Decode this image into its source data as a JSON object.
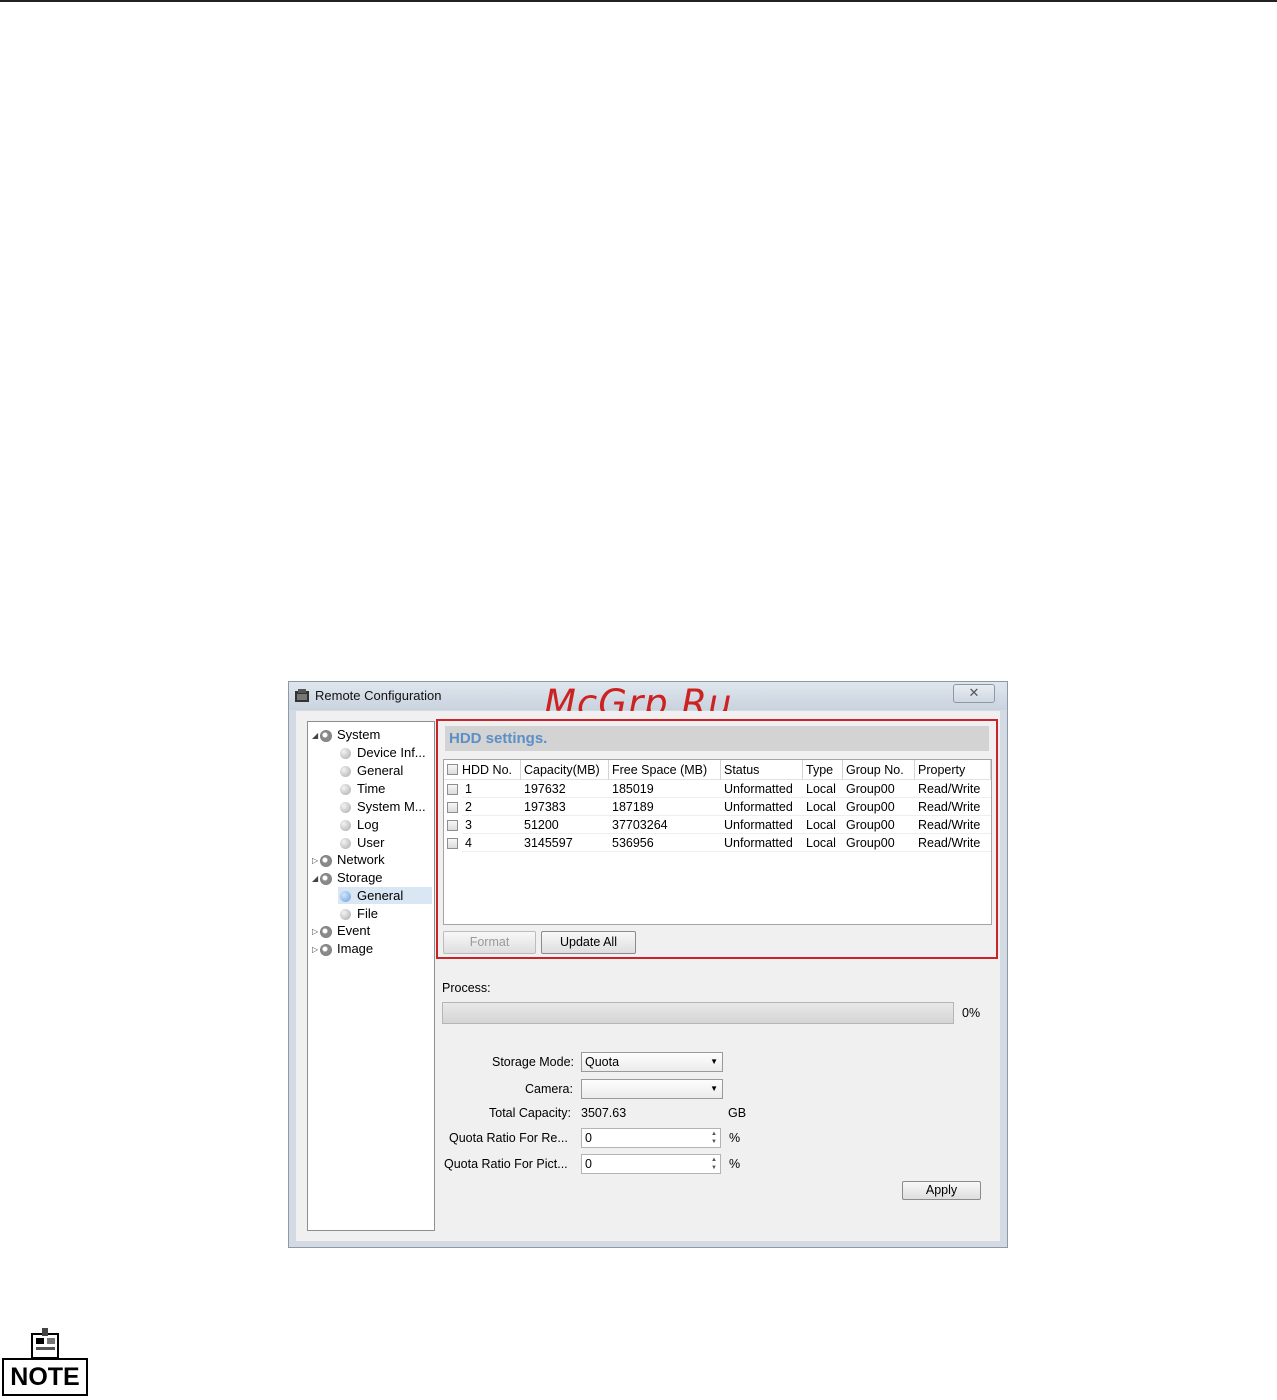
{
  "window": {
    "title": "Remote Configuration",
    "close_glyph": "✕",
    "watermark": "McGrp.Ru"
  },
  "tree": {
    "system": "System",
    "device_info": "Device Inf...",
    "general_sys": "General",
    "time": "Time",
    "system_m": "System M...",
    "log": "Log",
    "user": "User",
    "network": "Network",
    "storage": "Storage",
    "general_storage": "General",
    "file": "File",
    "event": "Event",
    "image": "Image"
  },
  "hdd": {
    "heading": "HDD settings.",
    "columns": [
      "HDD No.",
      "Capacity(MB)",
      "Free Space (MB)",
      "Status",
      "Type",
      "Group No.",
      "Property"
    ],
    "rows": [
      [
        "1",
        "197632",
        "185019",
        "Unformatted",
        "Local",
        "Group00",
        "Read/Write"
      ],
      [
        "2",
        "197383",
        "187189",
        "Unformatted",
        "Local",
        "Group00",
        "Read/Write"
      ],
      [
        "3",
        "51200",
        "37703264",
        "Unformatted",
        "Local",
        "Group00",
        "Read/Write"
      ],
      [
        "4",
        "3145597",
        "536956",
        "Unformatted",
        "Local",
        "Group00",
        "Read/Write"
      ]
    ],
    "format_button": "Format",
    "update_all_button": "Update All"
  },
  "process": {
    "label": "Process:",
    "progress_percent": 0,
    "percent_text": "0%"
  },
  "form": {
    "storage_mode_label": "Storage Mode:",
    "storage_mode_value": "Quota",
    "camera_label": "Camera:",
    "camera_value": "",
    "total_capacity_label": "Total Capacity:",
    "total_capacity_value": "3507.63",
    "total_capacity_unit": "GB",
    "quota_record_label": "Quota Ratio For Re...",
    "quota_record_value": "0",
    "quota_picture_label": "Quota Ratio For Pict...",
    "quota_picture_value": "0",
    "percent_unit": "%",
    "apply_button": "Apply"
  },
  "note": {
    "label": "NOTE"
  },
  "icons": {
    "app": "remote-config-icon",
    "tree_folder": "gear-icon",
    "tree_leaf": "dot-icon",
    "note": "note-icon"
  }
}
